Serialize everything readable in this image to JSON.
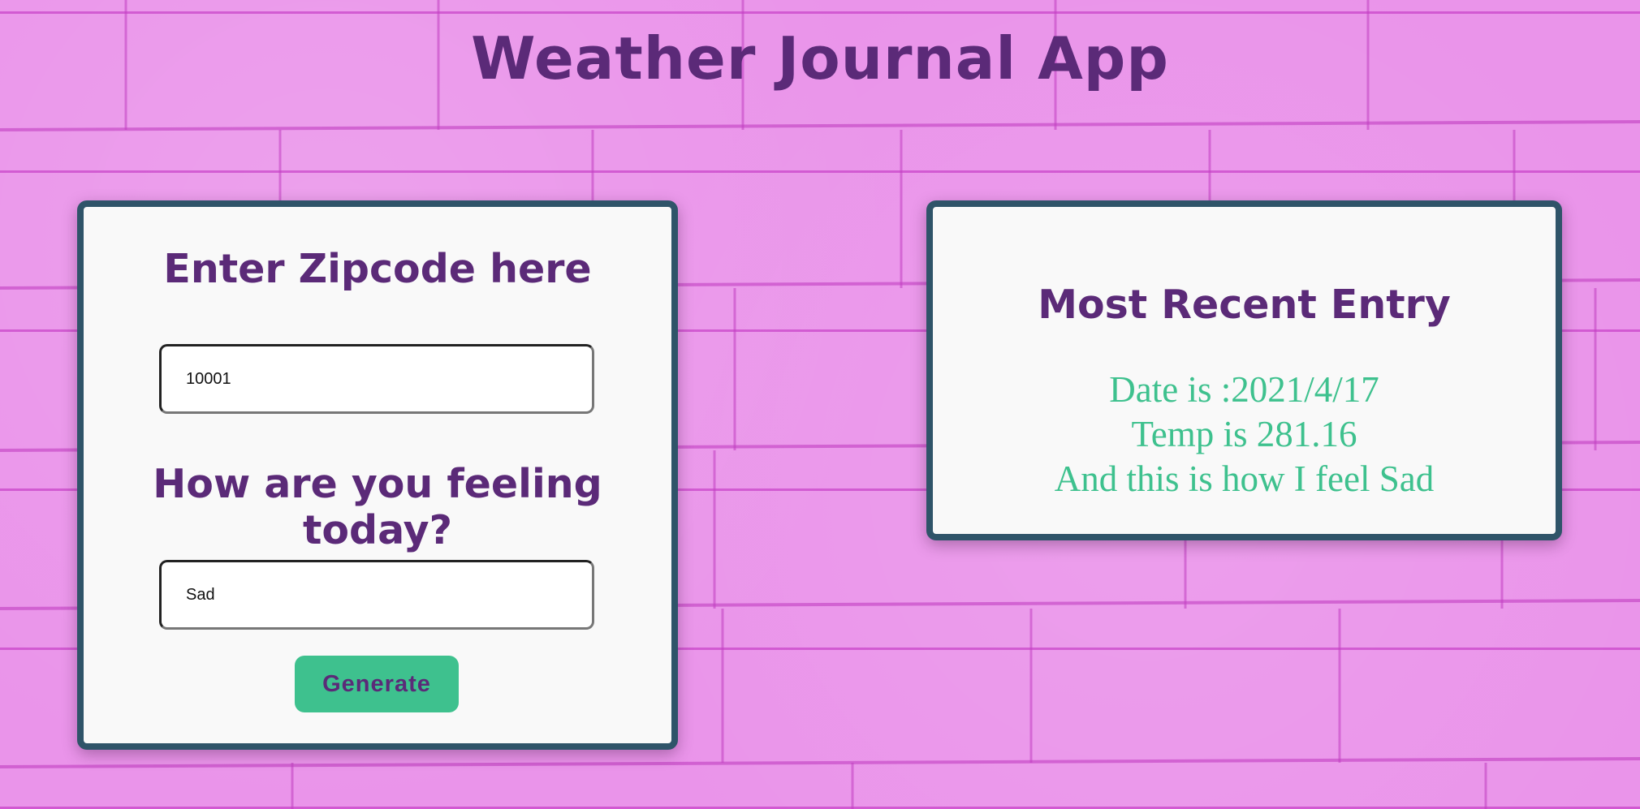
{
  "app": {
    "title": "Weather Journal App"
  },
  "form": {
    "zip_label": "Enter Zipcode here",
    "zip_value": "10001",
    "feelings_label": "How are you feeling today?",
    "feelings_value": "Sad",
    "generate_label": "Generate"
  },
  "entry": {
    "heading": "Most Recent Entry",
    "date": "Date is :2021/4/17",
    "temp": "Temp is 281.16",
    "content": "And this is how I feel Sad"
  },
  "colors": {
    "background": "#ea94ea",
    "mortar": "#be28be",
    "heading_text": "#5b2a78",
    "card_border": "#2f5469",
    "card_background": "#f9f9f9",
    "accent_green": "#3ec18e"
  }
}
